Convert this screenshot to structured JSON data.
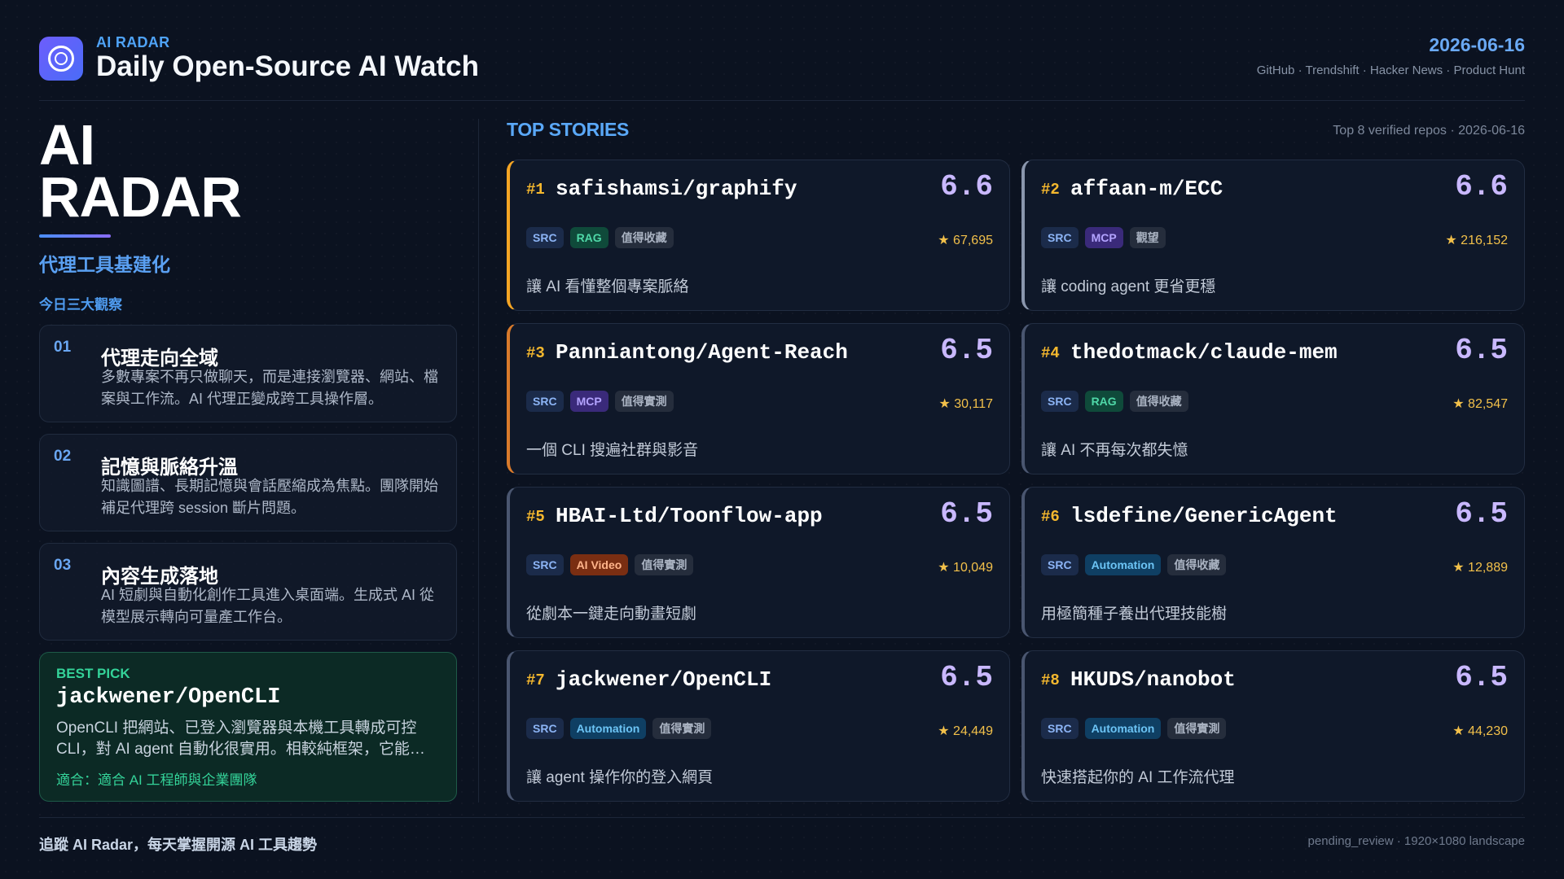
{
  "header": {
    "kicker": "AI RADAR",
    "title": "Daily Open-Source AI Watch",
    "date": "2026-06-16",
    "sources": "GitHub · Trendshift · Hacker News · Product Hunt",
    "logo_icon": "radar-ring-icon"
  },
  "left": {
    "big_title_line1": "AI",
    "big_title_line2": "RADAR",
    "subtitle": "代理工具基建化",
    "insights_heading": "今日三大觀察",
    "insights": [
      {
        "num": "01",
        "title": "代理走向全域",
        "desc": "多數專案不再只做聊天，而是連接瀏覽器、網站、檔案與工作流。AI 代理正變成跨工具操作層。"
      },
      {
        "num": "02",
        "title": "記憶與脈絡升溫",
        "desc": "知識圖譜、長期記憶與會話壓縮成為焦點。團隊開始補足代理跨 session 斷片問題。"
      },
      {
        "num": "03",
        "title": "內容生成落地",
        "desc": "AI 短劇與自動化創作工具進入桌面端。生成式 AI 從模型展示轉向可量產工作台。"
      }
    ],
    "best_pick": {
      "label": "BEST PICK",
      "repo": "jackwener/OpenCLI",
      "desc": "OpenCLI 把網站、已登入瀏覽器與本機工具轉成可控 CLI，對 AI agent 自動化很實用。相較純框架，它能…",
      "fit": "適合：適合 AI 工程師與企業團隊"
    }
  },
  "stories": {
    "title": "TOP STORIES",
    "meta": "Top 8 verified repos · 2026-06-16",
    "star_icon": "star-icon",
    "cards": [
      {
        "rank": "#1",
        "repo": "safishamsi/graphify",
        "score": "6.6",
        "tags": [
          {
            "label": "SRC",
            "kind": "src"
          },
          {
            "label": "RAG",
            "kind": "rag"
          },
          {
            "label": "值得收藏",
            "kind": "ghost"
          }
        ],
        "stars": "★ 67,695",
        "desc": "讓 AI 看懂整個專案脈絡"
      },
      {
        "rank": "#2",
        "repo": "affaan-m/ECC",
        "score": "6.6",
        "tags": [
          {
            "label": "SRC",
            "kind": "src"
          },
          {
            "label": "MCP",
            "kind": "mcp"
          },
          {
            "label": "觀望",
            "kind": "ghost"
          }
        ],
        "stars": "★ 216,152",
        "desc": "讓 coding agent 更省更穩"
      },
      {
        "rank": "#3",
        "repo": "Panniantong/Agent-Reach",
        "score": "6.5",
        "tags": [
          {
            "label": "SRC",
            "kind": "src"
          },
          {
            "label": "MCP",
            "kind": "mcp"
          },
          {
            "label": "值得實測",
            "kind": "ghost"
          }
        ],
        "stars": "★ 30,117",
        "desc": "一個 CLI 搜遍社群與影音"
      },
      {
        "rank": "#4",
        "repo": "thedotmack/claude-mem",
        "score": "6.5",
        "tags": [
          {
            "label": "SRC",
            "kind": "src"
          },
          {
            "label": "RAG",
            "kind": "rag"
          },
          {
            "label": "值得收藏",
            "kind": "ghost"
          }
        ],
        "stars": "★ 82,547",
        "desc": "讓 AI 不再每次都失憶"
      },
      {
        "rank": "#5",
        "repo": "HBAI-Ltd/Toonflow-app",
        "score": "6.5",
        "tags": [
          {
            "label": "SRC",
            "kind": "src"
          },
          {
            "label": "AI Video",
            "kind": "vid"
          },
          {
            "label": "值得實測",
            "kind": "ghost"
          }
        ],
        "stars": "★ 10,049",
        "desc": "從劇本一鍵走向動畫短劇"
      },
      {
        "rank": "#6",
        "repo": "lsdefine/GenericAgent",
        "score": "6.5",
        "tags": [
          {
            "label": "SRC",
            "kind": "src"
          },
          {
            "label": "Automation",
            "kind": "auto"
          },
          {
            "label": "值得收藏",
            "kind": "ghost"
          }
        ],
        "stars": "★ 12,889",
        "desc": "用極簡種子養出代理技能樹"
      },
      {
        "rank": "#7",
        "repo": "jackwener/OpenCLI",
        "score": "6.5",
        "tags": [
          {
            "label": "SRC",
            "kind": "src"
          },
          {
            "label": "Automation",
            "kind": "auto"
          },
          {
            "label": "值得實測",
            "kind": "ghost"
          }
        ],
        "stars": "★ 24,449",
        "desc": "讓 agent 操作你的登入網頁"
      },
      {
        "rank": "#8",
        "repo": "HKUDS/nanobot",
        "score": "6.5",
        "tags": [
          {
            "label": "SRC",
            "kind": "src"
          },
          {
            "label": "Automation",
            "kind": "auto"
          },
          {
            "label": "值得實測",
            "kind": "ghost"
          }
        ],
        "stars": "★ 44,230",
        "desc": "快速搭起你的 AI 工作流代理"
      }
    ]
  },
  "footer": {
    "cta": "追蹤 AI Radar，每天掌握開源 AI 工具趨勢",
    "meta": "pending_review · 1920×1080 landscape"
  }
}
